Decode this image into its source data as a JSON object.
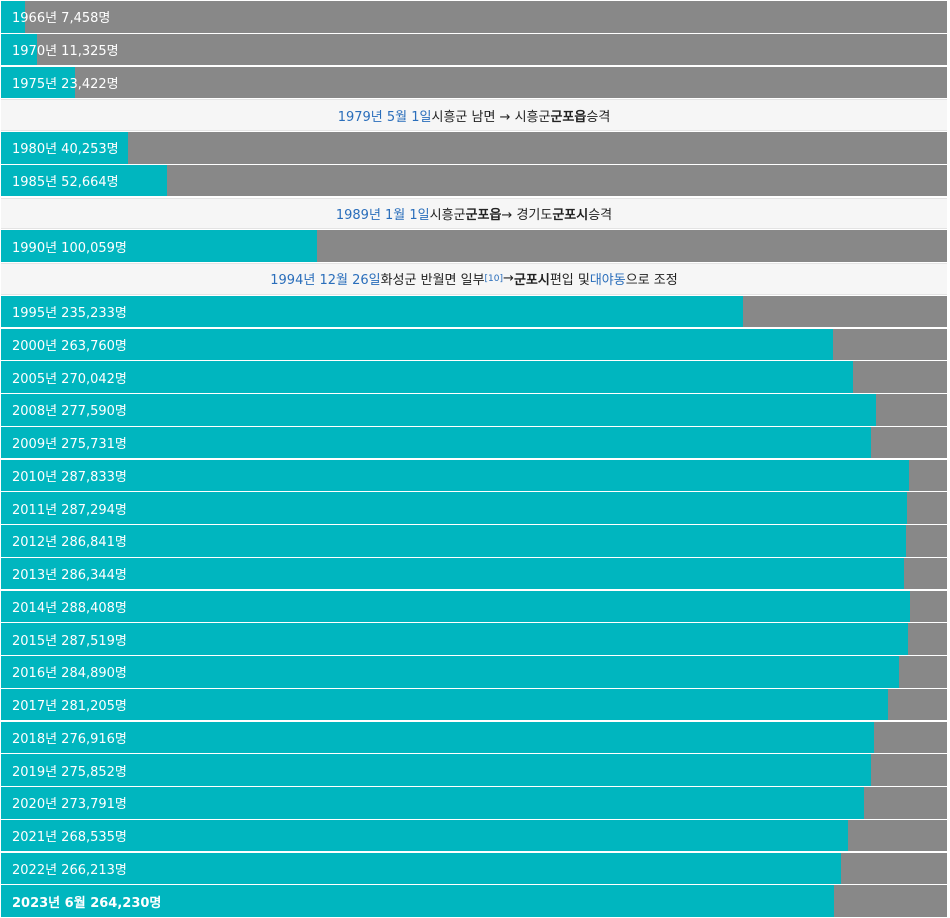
{
  "chart_data": {
    "type": "bar",
    "orientation": "horizontal",
    "max_value": 300000,
    "colors": {
      "fill": "#00b6bf",
      "track": "#888888",
      "event_bg": "#f6f6f6",
      "link": "#2a6ebb"
    },
    "rows": [
      {
        "kind": "bar",
        "label": "1966년 7,458명",
        "value": 7458
      },
      {
        "kind": "bar",
        "label": "1970년 11,325명",
        "value": 11325
      },
      {
        "kind": "bar",
        "label": "1975년 23,422명",
        "value": 23422
      },
      {
        "kind": "event",
        "date": "1979년 5월 1일",
        "parts": [
          {
            "t": " 시흥군 남면 → 시흥군 "
          },
          {
            "t": "군포읍",
            "bold": true
          },
          {
            "t": " 승격"
          }
        ]
      },
      {
        "kind": "bar",
        "label": "1980년 40,253명",
        "value": 40253
      },
      {
        "kind": "bar",
        "label": "1985년 52,664명",
        "value": 52664
      },
      {
        "kind": "event",
        "date": "1989년 1월 1일",
        "parts": [
          {
            "t": " 시흥군 "
          },
          {
            "t": "군포읍",
            "bold": true
          },
          {
            "t": " → 경기도 "
          },
          {
            "t": "군포시",
            "bold": true
          },
          {
            "t": " 승격"
          }
        ]
      },
      {
        "kind": "bar",
        "label": "1990년 100,059명",
        "value": 100059
      },
      {
        "kind": "event",
        "date": "1994년 12월 26일",
        "parts": [
          {
            "t": " 화성군 반월면 일부"
          },
          {
            "t": "[10]",
            "sup": true
          },
          {
            "t": " → "
          },
          {
            "t": "군포시",
            "bold": true
          },
          {
            "t": " 편입 및 "
          },
          {
            "t": "대야동",
            "link": true
          },
          {
            "t": "으로 조정"
          }
        ]
      },
      {
        "kind": "bar",
        "label": "1995년 235,233명",
        "value": 235233
      },
      {
        "kind": "bar",
        "label": "2000년 263,760명",
        "value": 263760
      },
      {
        "kind": "bar",
        "label": "2005년 270,042명",
        "value": 270042
      },
      {
        "kind": "bar",
        "label": "2008년 277,590명",
        "value": 277590
      },
      {
        "kind": "bar",
        "label": "2009년 275,731명",
        "value": 275731
      },
      {
        "kind": "bar",
        "label": "2010년 287,833명",
        "value": 287833
      },
      {
        "kind": "bar",
        "label": "2011년 287,294명",
        "value": 287294
      },
      {
        "kind": "bar",
        "label": "2012년 286,841명",
        "value": 286841
      },
      {
        "kind": "bar",
        "label": "2013년 286,344명",
        "value": 286344
      },
      {
        "kind": "bar",
        "label": "2014년 288,408명",
        "value": 288408
      },
      {
        "kind": "bar",
        "label": "2015년 287,519명",
        "value": 287519
      },
      {
        "kind": "bar",
        "label": "2016년 284,890명",
        "value": 284890
      },
      {
        "kind": "bar",
        "label": "2017년 281,205명",
        "value": 281205
      },
      {
        "kind": "bar",
        "label": "2018년 276,916명",
        "value": 276916
      },
      {
        "kind": "bar",
        "label": "2019년 275,852명",
        "value": 275852
      },
      {
        "kind": "bar",
        "label": "2020년 273,791명",
        "value": 273791
      },
      {
        "kind": "bar",
        "label": "2021년 268,535명",
        "value": 268535
      },
      {
        "kind": "bar",
        "label": "2022년 266,213명",
        "value": 266213
      },
      {
        "kind": "bar",
        "label": "2023년 6월 264,230명",
        "value": 264230,
        "bold": true
      }
    ]
  }
}
